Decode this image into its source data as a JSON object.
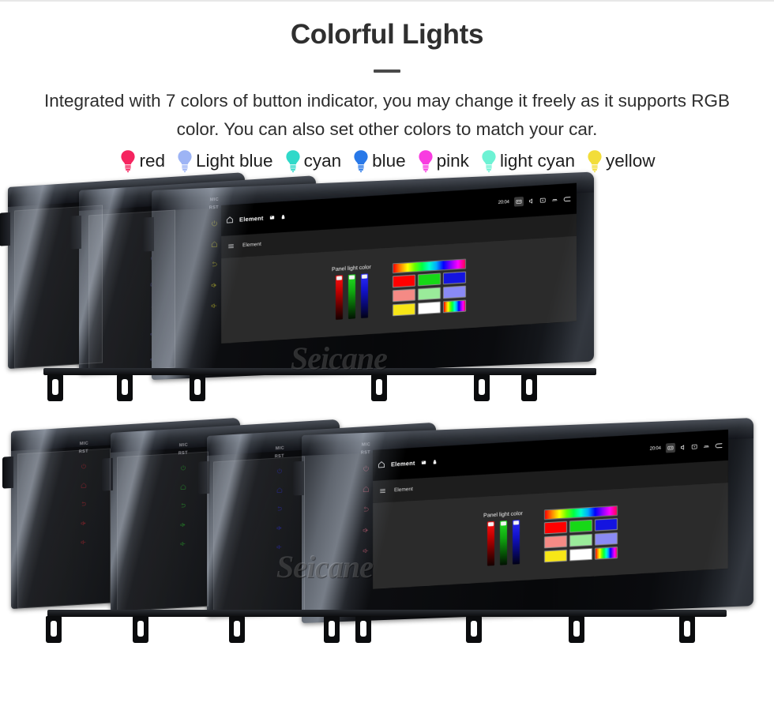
{
  "header": {
    "title": "Colorful Lights",
    "description": "Integrated with 7 colors of button indicator, you may change it freely as it supports RGB color. You can also set other colors to match your car."
  },
  "legend": {
    "items": [
      {
        "label": "red",
        "color": "#f5245f",
        "icon": "bulb-icon"
      },
      {
        "label": "Light blue",
        "color": "#9db4f5",
        "icon": "bulb-icon"
      },
      {
        "label": "cyan",
        "color": "#2fd9c9",
        "icon": "bulb-icon"
      },
      {
        "label": "blue",
        "color": "#2878e8",
        "icon": "bulb-icon"
      },
      {
        "label": "pink",
        "color": "#f83ce0",
        "icon": "bulb-icon"
      },
      {
        "label": "light cyan",
        "color": "#6df2d4",
        "icon": "bulb-icon"
      },
      {
        "label": "yellow",
        "color": "#f2dd3a",
        "icon": "bulb-icon"
      }
    ]
  },
  "watermark": {
    "text": "Seicane"
  },
  "screen": {
    "statusbar": {
      "home_icon": "home-icon",
      "title": "Element",
      "sd_icon": "sdcard-icon",
      "usb_icon": "usb-icon",
      "clock": "20:04",
      "screenshot_icon": "screenshot-icon",
      "mute_icon": "mute-icon",
      "display_icon": "display-icon",
      "eject_icon": "eject-icon",
      "back_icon": "back-arrow-icon"
    },
    "appbar": {
      "menu_icon": "hamburger-menu-icon",
      "title": "Element"
    },
    "panel": {
      "label": "Panel light color",
      "sliders": [
        {
          "name": "red-slider",
          "channel": "R",
          "value": 100
        },
        {
          "name": "green-slider",
          "channel": "G",
          "value": 100
        },
        {
          "name": "blue-slider",
          "channel": "B",
          "value": 100
        }
      ],
      "swatch_rows": [
        {
          "type": "rainbow-bar",
          "colors": [
            "#ff0000",
            "#ffff00",
            "#00ff00",
            "#00ffff",
            "#0000ff",
            "#ff00ff",
            "#ff0000"
          ]
        },
        {
          "type": "solid",
          "colors": [
            "#ff0000",
            "#17d817",
            "#1414e0"
          ]
        },
        {
          "type": "solid",
          "colors": [
            "#f58a85",
            "#9aeb9a",
            "#8a8af5"
          ]
        },
        {
          "type": "mixed",
          "colors": [
            "#f7e617",
            "#ffffff",
            "rainbow"
          ]
        }
      ]
    }
  },
  "keystrip": {
    "labels": [
      "MIC",
      "RST"
    ],
    "keys": [
      {
        "name": "power-key",
        "icon": "power-icon"
      },
      {
        "name": "home-key",
        "icon": "home-icon"
      },
      {
        "name": "back-key",
        "icon": "back-icon"
      },
      {
        "name": "volume-up-key",
        "icon": "volume-up-icon"
      },
      {
        "name": "volume-down-key",
        "icon": "volume-down-icon"
      }
    ]
  },
  "units": {
    "top_row": [
      {
        "name": "head-unit-light-cyan",
        "key_color": "#39e08a"
      },
      {
        "name": "head-unit-light-blue",
        "key_color": "#7b7bf0"
      },
      {
        "name": "head-unit-yellow",
        "key_color": "#e8e018",
        "has_screen": true
      }
    ],
    "bottom_row": [
      {
        "name": "head-unit-red",
        "key_color": "#e01b25"
      },
      {
        "name": "head-unit-green",
        "key_color": "#20d820"
      },
      {
        "name": "head-unit-blue",
        "key_color": "#2727ee"
      },
      {
        "name": "head-unit-pink",
        "key_color": "#f0637e",
        "has_screen": true
      }
    ]
  }
}
